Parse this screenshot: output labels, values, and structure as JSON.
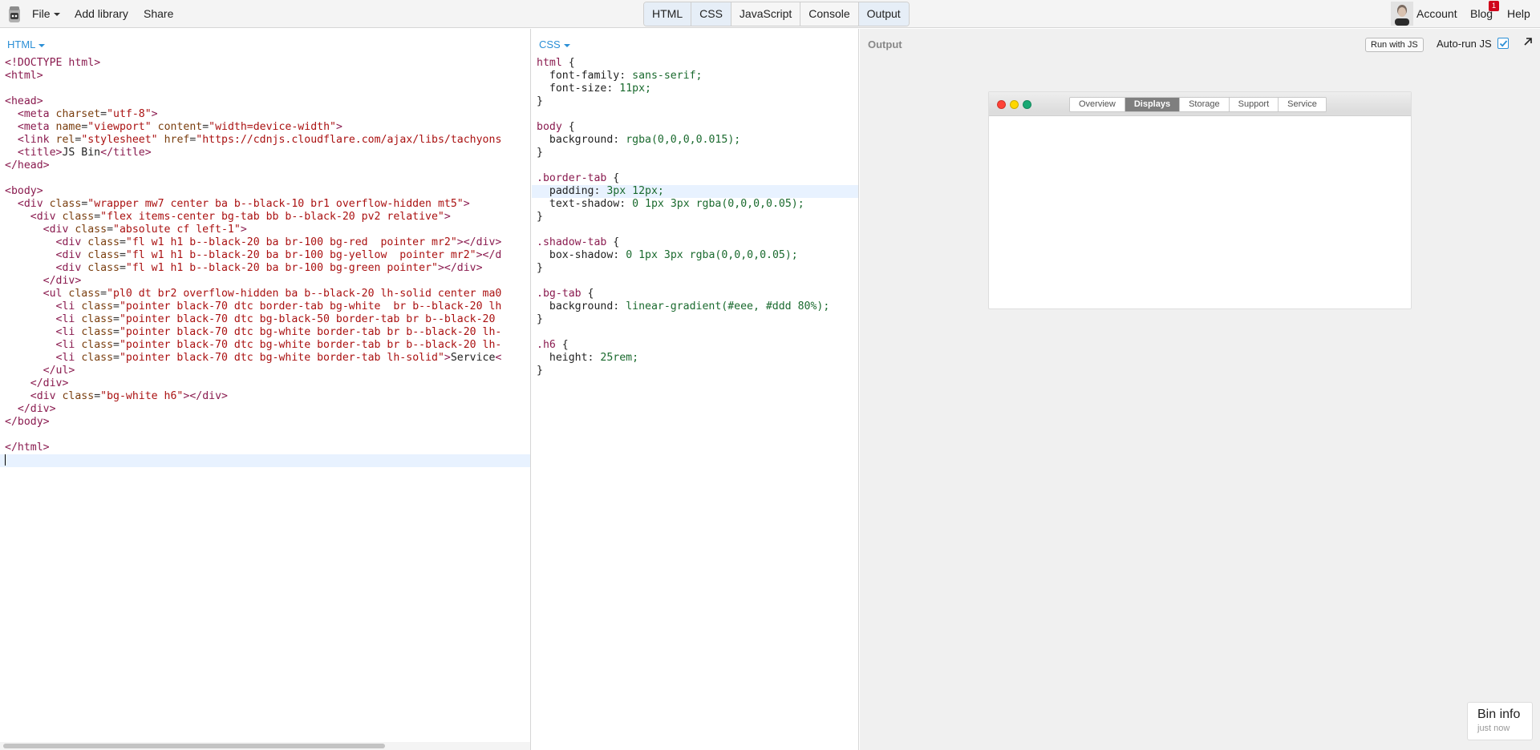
{
  "topbar": {
    "file_label": "File",
    "add_library_label": "Add library",
    "share_label": "Share",
    "panel_toggles": [
      "HTML",
      "CSS",
      "JavaScript",
      "Console",
      "Output"
    ],
    "account_label": "Account",
    "blog_label": "Blog",
    "blog_badge": "1",
    "help_label": "Help"
  },
  "html_panel": {
    "label": "HTML",
    "lines": [
      "<!DOCTYPE html>",
      "<html>",
      "",
      "<head>",
      "  <meta charset=\"utf-8\">",
      "  <meta name=\"viewport\" content=\"width=device-width\">",
      "  <link rel=\"stylesheet\" href=\"https://cdnjs.cloudflare.com/ajax/libs/tachyons",
      "  <title>JS Bin</title>",
      "</head>",
      "",
      "<body>",
      "  <div class=\"wrapper mw7 center ba b--black-10 br1 overflow-hidden mt5\">",
      "    <div class=\"flex items-center bg-tab bb b--black-20 pv2 relative\">",
      "      <div class=\"absolute cf left-1\">",
      "        <div class=\"fl w1 h1 b--black-20 ba br-100 bg-red  pointer mr2\"></div>",
      "        <div class=\"fl w1 h1 b--black-20 ba br-100 bg-yellow  pointer mr2\"></d",
      "        <div class=\"fl w1 h1 b--black-20 ba br-100 bg-green pointer\"></div>",
      "      </div>",
      "      <ul class=\"pl0 dt br2 overflow-hidden ba b--black-20 lh-solid center ma0",
      "        <li class=\"pointer black-70 dtc border-tab bg-white  br b--black-20 lh",
      "        <li class=\"pointer black-70 dtc bg-black-50 border-tab br b--black-20",
      "        <li class=\"pointer black-70 dtc bg-white border-tab br b--black-20 lh-",
      "        <li class=\"pointer black-70 dtc bg-white border-tab br b--black-20 lh-",
      "        <li class=\"pointer black-70 dtc bg-white border-tab lh-solid\">Service<",
      "      </ul>",
      "    </div>",
      "    <div class=\"bg-white h6\"></div>",
      "  </div>",
      "</body>",
      "",
      "</html>",
      ""
    ]
  },
  "css_panel": {
    "label": "CSS",
    "lines": [
      "html {",
      "  font-family: sans-serif;",
      "  font-size: 11px;",
      "}",
      "",
      "body {",
      "  background: rgba(0,0,0,0.015);",
      "}",
      "",
      ".border-tab {",
      "  padding: 3px 12px;",
      "  text-shadow: 0 1px 3px rgba(0,0,0,0.05);",
      "}",
      "",
      ".shadow-tab {",
      "  box-shadow: 0 1px 3px rgba(0,0,0,0.05);",
      "}",
      "",
      ".bg-tab {",
      "  background: linear-gradient(#eee, #ddd 80%);",
      "}",
      "",
      ".h6 {",
      "  height: 25rem;",
      "}"
    ]
  },
  "output_panel": {
    "label": "Output",
    "run_button_label": "Run with JS",
    "autorun_label": "Auto-run JS",
    "autorun_checked": true,
    "window_tabs": [
      "Overview",
      "Displays",
      "Storage",
      "Support",
      "Service"
    ],
    "active_tab": "Displays",
    "dot_colors": [
      "#ff4136",
      "#ffd700",
      "#19a974"
    ]
  },
  "bin_info": {
    "title": "Bin info",
    "subtitle": "just now"
  },
  "colors": {
    "accent": "#2b8fd6",
    "tag": "#8a1b4f",
    "string": "#a11",
    "value": "#1a6a2e"
  }
}
